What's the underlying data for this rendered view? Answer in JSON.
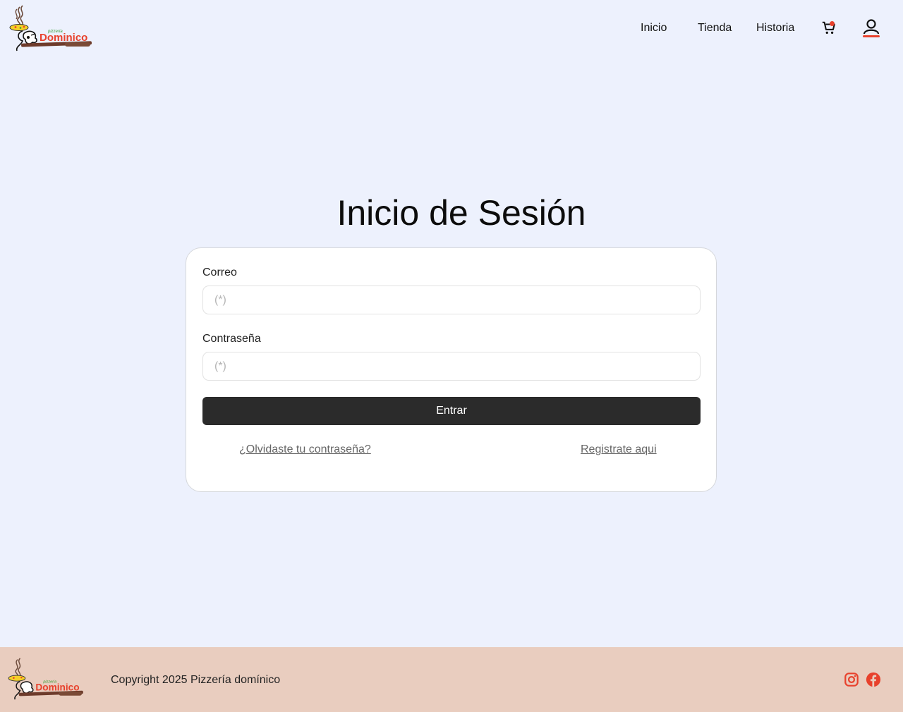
{
  "brand": {
    "logo_top_text": "pizzeria",
    "logo_main_text": "Dominico"
  },
  "nav": {
    "items": [
      "Inicio",
      "Tienda",
      "Historia"
    ],
    "cart_icon": "cart-icon",
    "user_icon": "user-icon"
  },
  "colors": {
    "background": "#edf1fd",
    "accent": "#e8412c",
    "button": "#2b2b2b",
    "footer": "#e9cdbf"
  },
  "login": {
    "title": "Inicio de Sesión",
    "email_label": "Correo",
    "email_placeholder": "(*)",
    "password_label": "Contraseña",
    "password_placeholder": "(*)",
    "submit_label": "Entrar",
    "forgot_link": "¿Olvidaste tu contraseña?",
    "register_link": "Registrate aqui"
  },
  "footer": {
    "copyright": "Copyright 2025 Pizzería domínico",
    "social": [
      "instagram-icon",
      "facebook-icon"
    ]
  }
}
